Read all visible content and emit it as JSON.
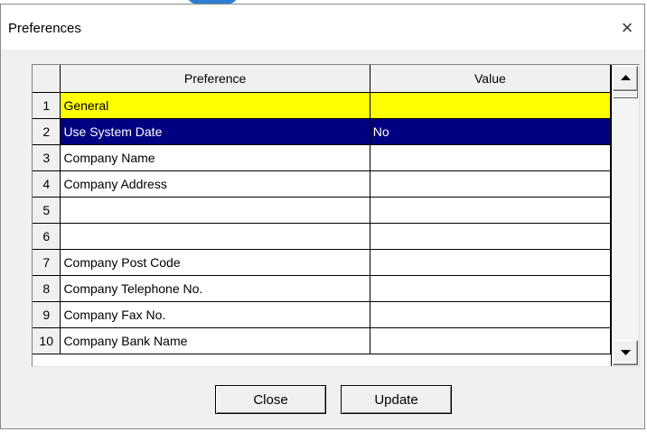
{
  "window": {
    "title": "Preferences",
    "close_glyph": "×"
  },
  "grid": {
    "columns": [
      "Preference",
      "Value"
    ],
    "rows": [
      {
        "num": "1",
        "preference": "General",
        "value": ""
      },
      {
        "num": "2",
        "preference": "Use System Date",
        "value": "No"
      },
      {
        "num": "3",
        "preference": "Company Name",
        "value": ""
      },
      {
        "num": "4",
        "preference": "Company Address",
        "value": ""
      },
      {
        "num": "5",
        "preference": "",
        "value": ""
      },
      {
        "num": "6",
        "preference": "",
        "value": ""
      },
      {
        "num": "7",
        "preference": "Company Post Code",
        "value": ""
      },
      {
        "num": "8",
        "preference": "Company Telephone No.",
        "value": ""
      },
      {
        "num": "9",
        "preference": "Company Fax No.",
        "value": ""
      },
      {
        "num": "10",
        "preference": "Company Bank Name",
        "value": ""
      }
    ],
    "highlight_row_color": "#ffff00",
    "selected_row_color": "#000080"
  },
  "buttons": {
    "close_label": "Close",
    "update_label": "Update"
  }
}
